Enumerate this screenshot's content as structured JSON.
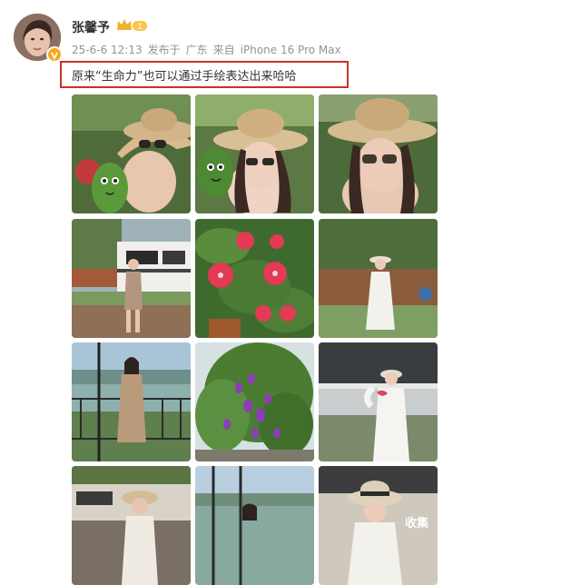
{
  "post": {
    "username": "张馨予",
    "level_badge": "1",
    "date": "25-6-6 12:13",
    "source_prefix": "发布于",
    "location": "广东",
    "device_prefix": "来自",
    "device": "iPhone 16 Pro Max",
    "text": "原来“生命力”也可以通过手绘表达出来哈哈"
  },
  "photos": [
    {
      "name": "photo-hat-green-gourd-1"
    },
    {
      "name": "photo-hat-green-gourd-2"
    },
    {
      "name": "photo-hat-closeup"
    },
    {
      "name": "photo-rv-outdoor"
    },
    {
      "name": "photo-pink-flowers"
    },
    {
      "name": "photo-white-robe-garden"
    },
    {
      "name": "photo-balcony-lake"
    },
    {
      "name": "photo-purple-flowers"
    },
    {
      "name": "photo-heart-hands"
    },
    {
      "name": "photo-rv-hat-1"
    },
    {
      "name": "photo-lake-view"
    },
    {
      "name": "photo-rv-hat-2"
    }
  ],
  "watermark": "收集",
  "colors": {
    "highlight_border": "#c8302a",
    "meta_text": "#939393",
    "badge": "#f7a721"
  }
}
